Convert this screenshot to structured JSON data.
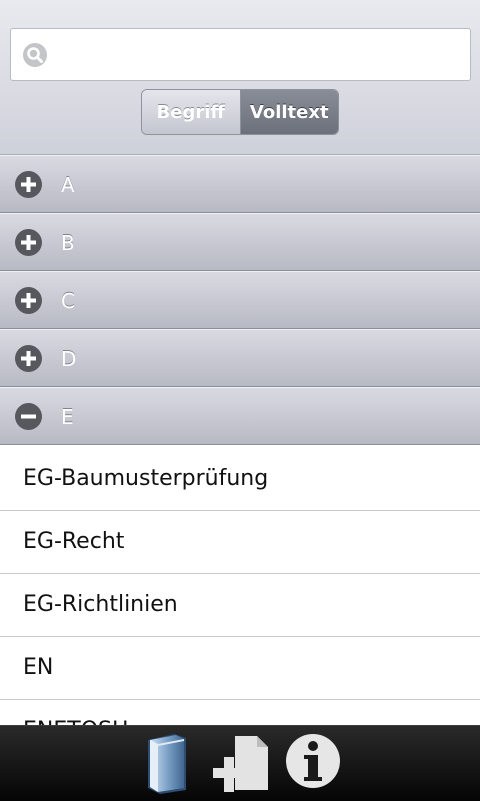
{
  "search": {
    "value": "",
    "placeholder": ""
  },
  "mode_toggle": {
    "begriff": "Begriff",
    "volltext": "Volltext",
    "selected": "Volltext"
  },
  "sections": [
    {
      "letter": "A",
      "expanded": false
    },
    {
      "letter": "B",
      "expanded": false
    },
    {
      "letter": "C",
      "expanded": false
    },
    {
      "letter": "D",
      "expanded": false
    },
    {
      "letter": "E",
      "expanded": true
    }
  ],
  "terms": [
    "EG-Baumusterprüfung",
    "EG-Recht",
    "EG-Richtlinien",
    "EN",
    "ENETOSH"
  ],
  "toolbar": {
    "icons": [
      "book-icon",
      "add-document-icon",
      "info-icon"
    ]
  },
  "colors": {
    "header_bg": "#d8dae2",
    "section_bg": "#c9cbd4",
    "toggle_selected": "#7a7e88",
    "bottom_bar": "#111111"
  }
}
